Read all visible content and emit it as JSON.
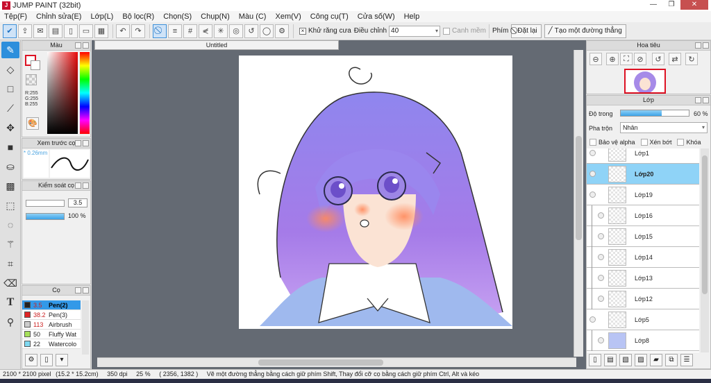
{
  "window": {
    "title": "JUMP PAINT (32bit)"
  },
  "menu": [
    "Tệp(F)",
    "Chỉnh sửa(E)",
    "Lớp(L)",
    "Bộ lọc(R)",
    "Chọn(S)",
    "Chụp(N)",
    "Màu (C)",
    "Xem(V)",
    "Công cụ(T)",
    "Cửa số(W)",
    "Help"
  ],
  "toolbar": {
    "antialias_label": "Khử răng cưa",
    "adjust_label": "Điều chỉnh",
    "adjust_value": "40",
    "smooth_label": "Canh mềm",
    "key_label": "Phím",
    "reset_label": "Đặt lại",
    "straight_line_label": "Tạo một đường thẳng"
  },
  "color_panel": {
    "title": "Màu",
    "r": "R:255",
    "g": "G:255",
    "b": "B:255"
  },
  "preview_panel": {
    "title": "Xem trước cọ",
    "size": "* 0.26mm"
  },
  "control_panel": {
    "title": "Kiểm soát cọ",
    "size_value": "3.5",
    "opacity_value": "100 %",
    "opacity_fraction": 1.0
  },
  "brush_panel": {
    "title": "Cọ",
    "brushes": [
      {
        "size": "3.5",
        "name": "Pen(2)",
        "color": "#222222",
        "selected": true
      },
      {
        "size": "38.2",
        "name": "Pen(3)",
        "color": "#e02424",
        "selected": false
      },
      {
        "size": "113",
        "name": "Airbrush",
        "color": "#cccccc",
        "selected": false
      },
      {
        "size": "50",
        "name": "Fluffy Wat",
        "color": "#a6e05a",
        "selected": false
      },
      {
        "size": "22",
        "name": "Watercolo",
        "color": "#7fd8f0",
        "selected": false
      }
    ]
  },
  "document": {
    "tab": "Untitled"
  },
  "navigator": {
    "title": "Hoa tiêu"
  },
  "layer_panel": {
    "title": "Lớp",
    "opacity_label": "Độ trong",
    "opacity_value": "60 %",
    "opacity_fraction": 0.6,
    "blend_label": "Pha trộn",
    "blend_value": "Nhân",
    "protect_alpha": "Bảo vệ alpha",
    "clipping": "Xén bớt",
    "lock": "Khóa",
    "layers": [
      {
        "name": "Lớp1",
        "selected": false,
        "in_folder": false
      },
      {
        "name": "Lớp20",
        "selected": true,
        "in_folder": false
      },
      {
        "name": "Lớp19",
        "selected": false,
        "in_folder": false
      },
      {
        "name": "Lớp16",
        "selected": false,
        "in_folder": true
      },
      {
        "name": "Lớp15",
        "selected": false,
        "in_folder": true
      },
      {
        "name": "Lớp14",
        "selected": false,
        "in_folder": true
      },
      {
        "name": "Lớp13",
        "selected": false,
        "in_folder": true
      },
      {
        "name": "Lớp12",
        "selected": false,
        "in_folder": true
      },
      {
        "name": "Lớp5",
        "selected": false,
        "in_folder": false
      },
      {
        "name": "Lớp8",
        "selected": false,
        "in_folder": true
      }
    ]
  },
  "status": {
    "pixels": "2100 * 2100 pixel",
    "cm": "(15.2 * 15.2cm)",
    "dpi": "350 dpi",
    "zoom": "25 %",
    "coords": "( 2356, 1382 )",
    "hint": "Vẽ một đường thẳng bằng cách giữ phím Shift, Thay đổi cỡ cọ bằng cách giữ phím Ctrl, Alt và kéo"
  }
}
